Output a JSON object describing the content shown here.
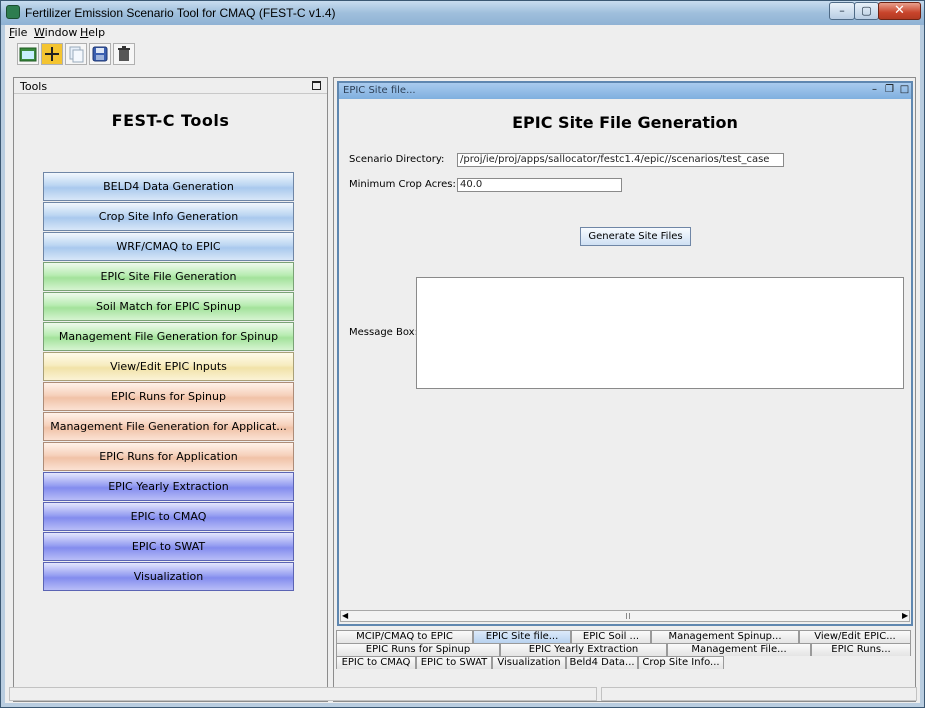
{
  "window": {
    "title": "Fertilizer Emission Scenario Tool for CMAQ (FEST-C v1.4)",
    "caption_min": "–",
    "caption_max": "▢",
    "caption_close": "✕"
  },
  "menubar": {
    "file": "File",
    "window": "Window",
    "help": "Help"
  },
  "toolbar": {
    "icons": [
      "open-folder-icon",
      "add-icon",
      "copy-icon",
      "save-icon",
      "trash-icon"
    ]
  },
  "tools_panel": {
    "header": "Tools",
    "title": "FEST-C Tools",
    "buttons": [
      {
        "label": "BELD4 Data Generation",
        "color": "blue"
      },
      {
        "label": "Crop Site Info Generation",
        "color": "blue"
      },
      {
        "label": "WRF/CMAQ to EPIC",
        "color": "blue"
      },
      {
        "label": "EPIC Site File Generation",
        "color": "green"
      },
      {
        "label": "Soil Match for EPIC Spinup",
        "color": "green"
      },
      {
        "label": "Management File Generation for Spinup",
        "color": "green"
      },
      {
        "label": "View/Edit EPIC Inputs",
        "color": "yellow"
      },
      {
        "label": "EPIC Runs for Spinup",
        "color": "orange"
      },
      {
        "label": "Management File Generation for Applicat...",
        "color": "orange"
      },
      {
        "label": "EPIC Runs for Application",
        "color": "orange"
      },
      {
        "label": "EPIC Yearly Extraction",
        "color": "violet"
      },
      {
        "label": "EPIC to CMAQ",
        "color": "violet"
      },
      {
        "label": "EPIC to SWAT",
        "color": "violet"
      },
      {
        "label": "Visualization",
        "color": "violet"
      }
    ]
  },
  "internal_frame": {
    "title": "EPIC Site file...",
    "heading": "EPIC Site File Generation",
    "scenario_dir_label": "Scenario Directory:",
    "scenario_dir_value": "/proj/ie/proj/apps/sallocator/festc1.4/epic//scenarios/test_case",
    "min_crop_label": "Minimum Crop Acres:",
    "min_crop_value": "40.0",
    "generate_button": "Generate Site Files",
    "message_label": "Message Box:",
    "message_value": ""
  },
  "tabs": {
    "row1": [
      "MCIP/CMAQ to EPIC",
      "EPIC Site file...",
      "EPIC Soil ...",
      "Management Spinup...",
      "View/Edit EPIC..."
    ],
    "row2": [
      "EPIC Runs for Spinup",
      "EPIC Yearly Extraction",
      "Management File...",
      "EPIC Runs..."
    ],
    "row3": [
      "EPIC to CMAQ",
      "EPIC to SWAT",
      "Visualization",
      "Beld4 Data...",
      "Crop Site Info..."
    ]
  },
  "colors": {
    "blue": "#bcd6f2",
    "green": "#b8ecb2",
    "yellow": "#f7ecc0",
    "orange": "#f6d1bc",
    "violet": "#98a0f2",
    "frame_title": "#7fafdf"
  }
}
